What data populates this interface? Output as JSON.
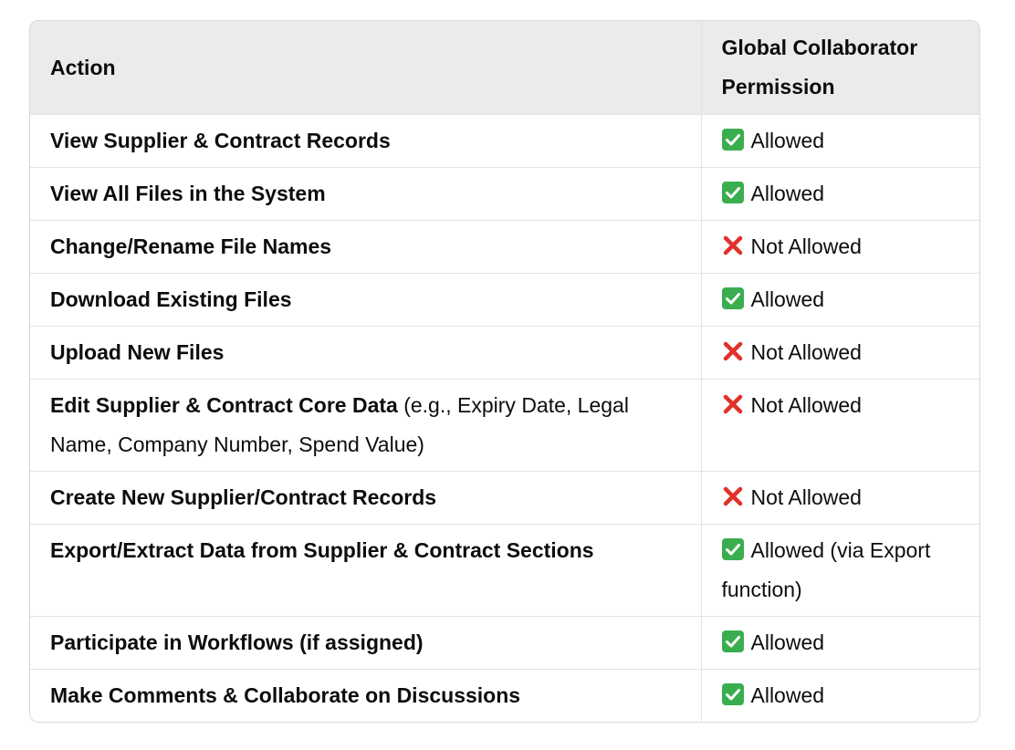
{
  "table": {
    "headers": {
      "action": "Action",
      "permission": "Global Collaborator Permission"
    },
    "rows": [
      {
        "action": "View Supplier & Contract Records",
        "note": "",
        "status": "allowed",
        "permission": "Allowed"
      },
      {
        "action": "View All Files in the System",
        "note": "",
        "status": "allowed",
        "permission": "Allowed"
      },
      {
        "action": "Change/Rename File Names",
        "note": "",
        "status": "denied",
        "permission": "Not Allowed"
      },
      {
        "action": "Download Existing Files",
        "note": "",
        "status": "allowed",
        "permission": "Allowed"
      },
      {
        "action": "Upload New Files",
        "note": "",
        "status": "denied",
        "permission": "Not Allowed"
      },
      {
        "action": "Edit Supplier & Contract Core Data",
        "note": " (e.g., Expiry Date, Legal Name, Company Number, Spend Value)",
        "status": "denied",
        "permission": "Not Allowed"
      },
      {
        "action": "Create New Supplier/Contract Records",
        "note": "",
        "status": "denied",
        "permission": "Not Allowed"
      },
      {
        "action": "Export/Extract Data from Supplier & Contract Sections",
        "note": "",
        "status": "allowed",
        "permission": "Allowed (via Export function)"
      },
      {
        "action": "Participate in Workflows (if assigned)",
        "note": "",
        "status": "allowed",
        "permission": "Allowed"
      },
      {
        "action": "Make Comments & Collaborate on Discussions",
        "note": "",
        "status": "allowed",
        "permission": "Allowed"
      }
    ]
  },
  "icons": {
    "allowed": "check-mark-icon",
    "denied": "cross-mark-icon"
  },
  "colors": {
    "allowed": "#3aae4f",
    "denied": "#e0312a",
    "header_bg": "#ebebeb"
  }
}
